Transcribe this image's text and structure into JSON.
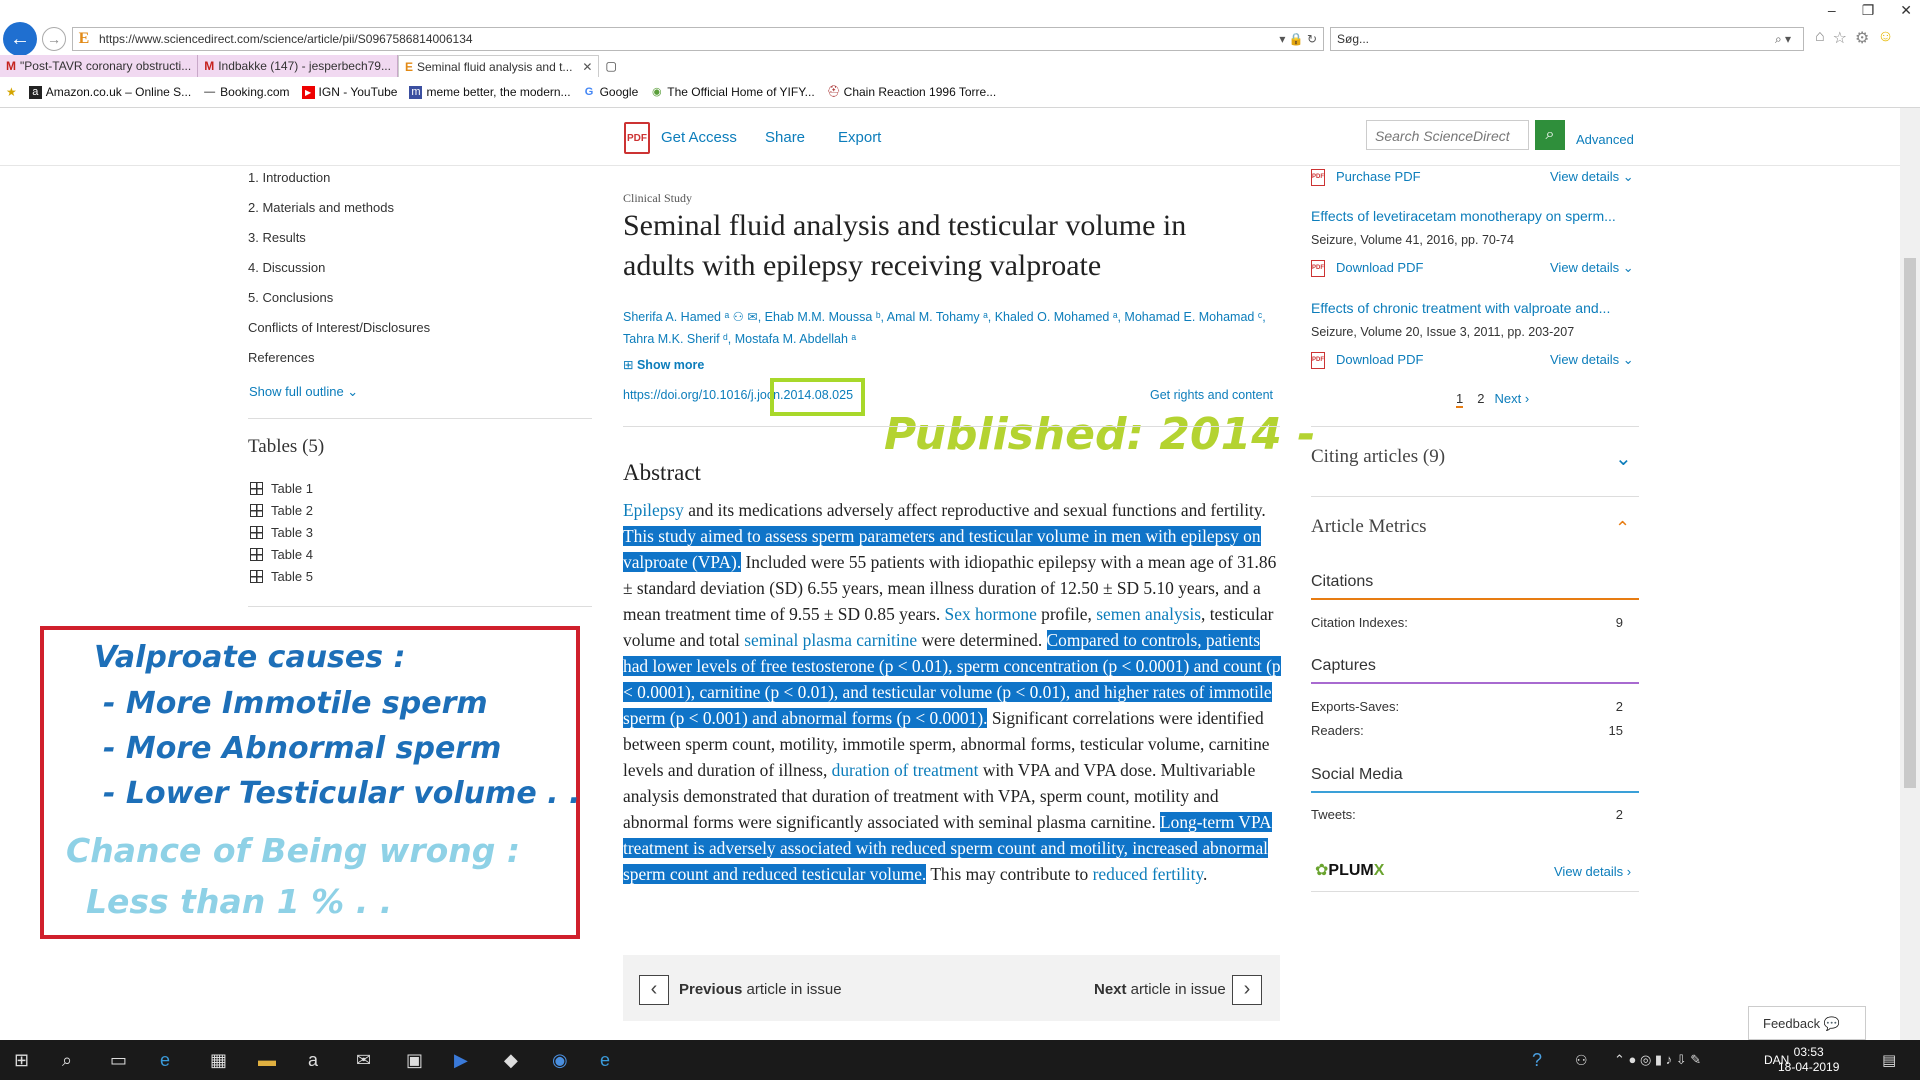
{
  "browser": {
    "url": "https://www.sciencedirect.com/science/article/pii/S0967586814006134",
    "search_placeholder": "Søg...",
    "tabs": [
      {
        "label": "\"Post-TAVR coronary obstructi..."
      },
      {
        "label": "Indbakke (147) - jesperbech79..."
      },
      {
        "label": "Seminal fluid analysis and t..."
      }
    ],
    "favorites": [
      {
        "label": "Amazon.co.uk – Online S...",
        "icon": "a"
      },
      {
        "label": "Booking.com",
        "icon": "—"
      },
      {
        "label": "IGN - YouTube",
        "icon": "▶"
      },
      {
        "label": "meme better, the modern...",
        "icon": "m"
      },
      {
        "label": "Google",
        "icon": "G"
      },
      {
        "label": "The Official Home of YIFY...",
        "icon": "◉"
      },
      {
        "label": "Chain Reaction 1996 Torre...",
        "icon": "⛑"
      }
    ]
  },
  "toolbar": {
    "get_access": "Get Access",
    "share": "Share",
    "export": "Export",
    "search_placeholder": "Search ScienceDirect",
    "advanced": "Advanced"
  },
  "outline": {
    "items": [
      "1. Introduction",
      "2. Materials and methods",
      "3. Results",
      "4. Discussion",
      "5. Conclusions",
      "Conflicts of Interest/Disclosures",
      "References"
    ],
    "show_full": "Show full outline",
    "tables_heading": "Tables (5)",
    "tables": [
      "Table 1",
      "Table 2",
      "Table 3",
      "Table 4",
      "Table 5"
    ]
  },
  "annotation": {
    "line1": "Valproate causes :",
    "line2": "- More Immotile sperm",
    "line3": "- More Abnormal sperm",
    "line4": "- Lower Testicular volume . .",
    "line5": "Chance of Being wrong :",
    "line6": "Less than 1 % . ."
  },
  "article": {
    "kicker": "Clinical Study",
    "title": "Seminal fluid analysis and testicular volume in adults with epilepsy receiving valproate",
    "authors_line1": "Sherifa A. Hamed ᵃ ⚇ ✉, Ehab M.M. Moussa ᵇ, Amal M. Tohamy ᵃ, Khaled O. Mohamed ᵃ, Mohamad E. Mohamad ᶜ,",
    "authors_line2": "Tahra M.K. Sherif ᵈ, Mostafa M. Abdellah ᵃ",
    "show_more": "Show more",
    "doi": "https://doi.org/10.1016/j.jocn.2014.08.025",
    "rights": "Get rights and content",
    "published_note": "Published: 2014 -",
    "abstract_heading": "Abstract",
    "abs": {
      "p1": "Epilepsy",
      "p2": " and its medications adversely affect reproductive and sexual functions and fertility. ",
      "p3": "This study aimed to assess sperm parameters and testicular volume in men with epilepsy on valproate (VPA).",
      "p4": " Included were 55 patients with idiopathic epilepsy with a mean age of 31.86 ± standard deviation (SD) 6.55 years, mean illness duration of 12.50 ± SD 5.10 years, and a mean treatment time of 9.55 ± SD 0.85 years. ",
      "p5": "Sex hormone",
      "p6": " profile, ",
      "p7": "semen analysis",
      "p8": ", testicular volume and total ",
      "p9": "seminal plasma carnitine",
      "p10": " were determined. ",
      "p11": "Compared to controls, patients had lower levels of free testosterone (p < 0.01), sperm concentration (p < 0.0001) and count (p < 0.0001), carnitine (p < 0.01), and testicular volume (p < 0.01), and higher rates of immotile sperm (p < 0.001) and abnormal forms (p < 0.0001).",
      "p12": " Significant correlations were identified between sperm count, motility, immotile sperm, abnormal forms, testicular volume, carnitine levels and duration of illness, ",
      "p13": "duration of treatment",
      "p14": " with VPA and VPA dose. Multivariable analysis demonstrated that duration of treatment with VPA, sperm count, motility and abnormal forms were significantly associated with seminal plasma carnitine. ",
      "p15": "Long-term VPA treatment is adversely associated with reduced sperm count and motility, increased abnormal sperm count and reduced testicular volume.",
      "p16": " This may contribute to ",
      "p17": "reduced fertility",
      "p18": "."
    },
    "prev_bold": "Previous",
    "prev_rest": " article in issue",
    "next_bold": "Next",
    "next_rest": " article in issue"
  },
  "sidebar": {
    "purchase_pdf": "Purchase PDF",
    "view_details": "View details",
    "rec1_title": "Effects of levetiracetam monotherapy on sperm...",
    "rec1_meta": "Seizure, Volume 41, 2016, pp. 70-74",
    "rec2_title": "Effects of chronic treatment with valproate and...",
    "rec2_meta": "Seizure, Volume 20, Issue 3, 2011, pp. 203-207",
    "download_pdf": "Download PDF",
    "page1": "1",
    "page2": "2",
    "next": "Next",
    "citing": "Citing articles (9)",
    "metrics": "Article Metrics",
    "citations": "Citations",
    "citation_indexes_label": "Citation Indexes:",
    "citation_indexes": "9",
    "captures": "Captures",
    "exports_label": "Exports-Saves:",
    "exports": "2",
    "readers_label": "Readers:",
    "readers": "15",
    "social": "Social Media",
    "tweets_label": "Tweets:",
    "tweets": "2",
    "plumx_a": "PLUM",
    "plumx_b": "X",
    "plumx_details": "View details"
  },
  "feedback": "Feedback",
  "taskbar": {
    "lang": "DAN",
    "time": "03:53",
    "date": "18-04-2019"
  },
  "colors": {
    "link": "#0c7dbb",
    "highlight": "#0f74c8",
    "annotation_border": "#d0202c",
    "published": "#b4d331"
  }
}
